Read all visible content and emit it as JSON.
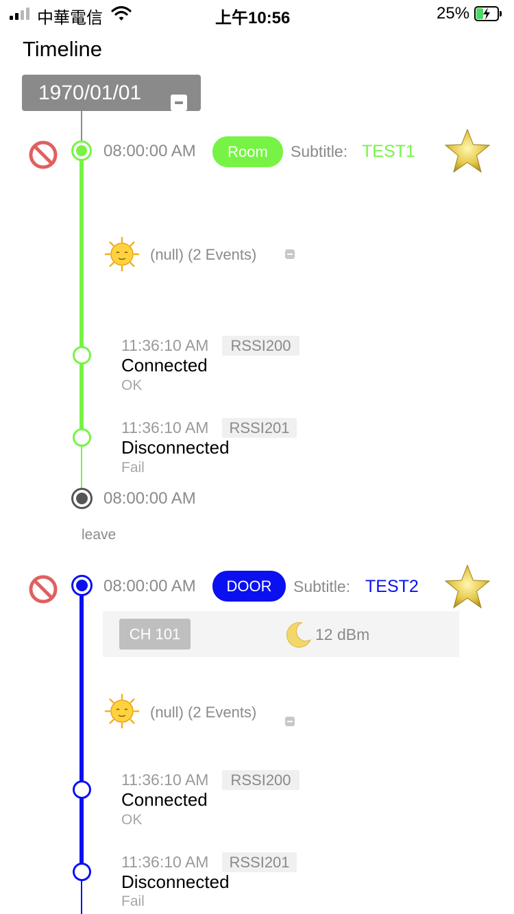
{
  "status_bar": {
    "carrier": "中華電信",
    "time": "上午10:56",
    "battery_percent": "25%",
    "battery_level": 0.25,
    "icons": [
      "signal-icon",
      "wifi-icon",
      "battery-charging-icon"
    ]
  },
  "header": {
    "title": "Timeline",
    "date": "1970/01/01",
    "collapse_icon": "minus-square-icon"
  },
  "colors": {
    "green": "#77f345",
    "blue": "#0a10f0",
    "gray_node": "#555555",
    "header_gray": "#8a8a8a",
    "no_entry_red": "#e06060"
  },
  "sections": [
    {
      "time": "08:00:00 AM",
      "category": "Room",
      "subtitle_label": "Subtitle:",
      "subtitle_value": "TEST1",
      "group": {
        "label": "(null) (2 Events)",
        "icon": "sun-face-icon"
      },
      "events": [
        {
          "time": "11:36:10 AM",
          "tag": "RSSI200",
          "title": "Connected",
          "status": "OK"
        },
        {
          "time": "11:36:10 AM",
          "tag": "RSSI201",
          "title": "Disconnected",
          "status": "Fail"
        }
      ],
      "end_time": "08:00:00 AM",
      "note": "leave"
    },
    {
      "time": "08:00:00 AM",
      "category": "DOOR",
      "subtitle_label": "Subtitle:",
      "subtitle_value": "TEST2",
      "info": {
        "channel": "CH 101",
        "power": "12 dBm",
        "power_icon": "moon-icon"
      },
      "group": {
        "label": "(null) (2 Events)",
        "icon": "sun-face-icon"
      },
      "events": [
        {
          "time": "11:36:10 AM",
          "tag": "RSSI200",
          "title": "Connected",
          "status": "OK"
        },
        {
          "time": "11:36:10 AM",
          "tag": "RSSI201",
          "title": "Disconnected",
          "status": "Fail"
        }
      ]
    }
  ]
}
